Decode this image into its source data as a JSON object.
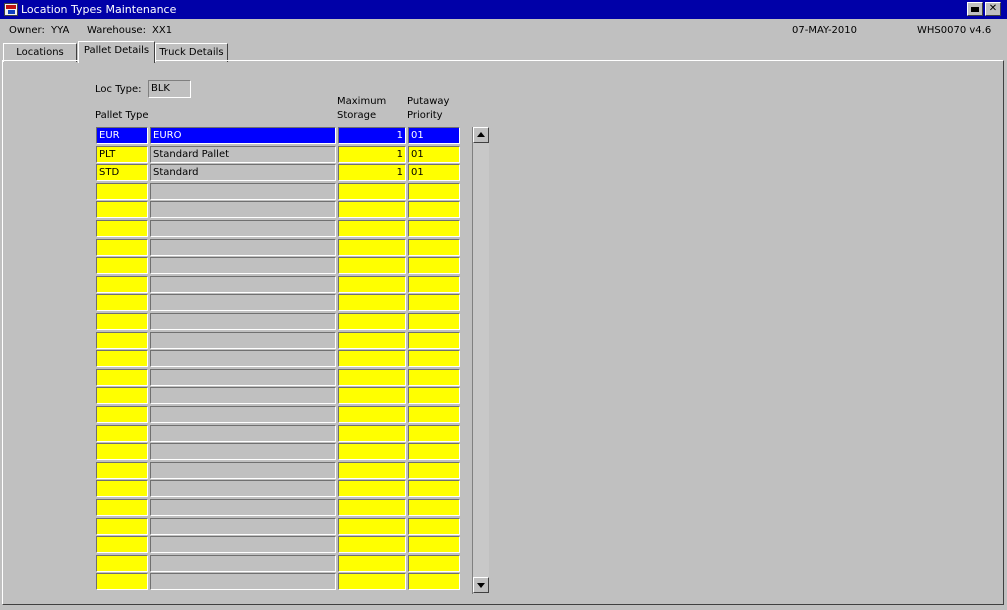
{
  "window": {
    "title": "Location Types Maintenance",
    "min_label": "",
    "close_label": "✕"
  },
  "info": {
    "owner_label": "Owner:",
    "owner": "YYA",
    "warehouse_label": "Warehouse:",
    "warehouse": "XX1",
    "date": "07-MAY-2010",
    "version": "WHS0070  v4.6"
  },
  "tabs": [
    {
      "label": "Locations"
    },
    {
      "label": "Pallet Details"
    },
    {
      "label": "Truck Details"
    }
  ],
  "form": {
    "loc_type_label": "Loc Type:",
    "loc_type": "BLK",
    "col_pallet_type": "Pallet Type",
    "col_max_storage_1": "Maximum",
    "col_max_storage_2": "Storage",
    "col_putaway_1": "Putaway",
    "col_putaway_2": "Priority"
  },
  "rows": [
    {
      "code": "EUR",
      "desc": "EURO",
      "max": "1",
      "priority": "01"
    },
    {
      "code": "PLT",
      "desc": "Standard Pallet",
      "max": "1",
      "priority": "01"
    },
    {
      "code": "STD",
      "desc": "Standard",
      "max": "1",
      "priority": "01"
    }
  ],
  "total_rows": 25,
  "selected_row": 0,
  "colors": {
    "titlebar": "#0000a8",
    "field_required": "#ffff00",
    "selection": "#0000ff"
  }
}
